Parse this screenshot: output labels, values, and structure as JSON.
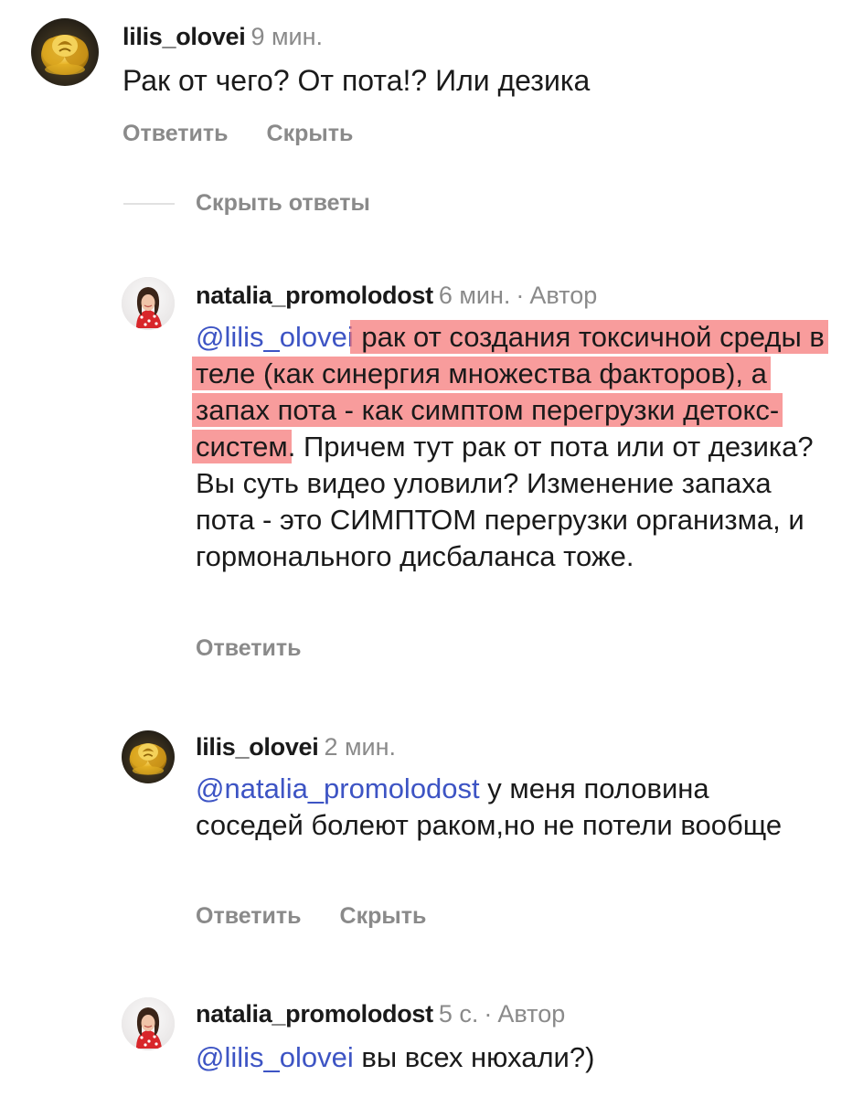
{
  "comments": [
    {
      "author": "lilis_olovei",
      "time": "9 мин.",
      "text": "Рак от чего? От пота!? Или дезика",
      "actions": [
        "Ответить",
        "Скрыть"
      ]
    },
    {
      "author": "natalia_promolodost",
      "time": "6 мин.",
      "separator": "·",
      "badge": "Автор",
      "mention": "@lilis_olovei",
      "highlighted_text": " рак от создания токсичной среды в теле (как синергия множества факторов), а запах пота - как симптом перегрузки детокс-систем",
      "text_after": ". Причем тут рак от пота или от дезика? Вы суть видео уловили? Изменение запаха пота - это СИМПТОМ перегрузки организма, и гормонального дисбаланса тоже.",
      "actions": [
        "Ответить"
      ]
    },
    {
      "author": "lilis_olovei",
      "time": "2 мин.",
      "mention": "@natalia_promolodost",
      "text": " у меня половина соседей болеют раком,но не потели вообще",
      "actions": [
        "Ответить",
        "Скрыть"
      ]
    },
    {
      "author": "natalia_promolodost",
      "time": "5 с.",
      "separator": "·",
      "badge": "Автор",
      "mention": "@lilis_olovei",
      "text": " вы всех нюхали?)"
    }
  ],
  "thread": {
    "hide_replies_label": "Скрыть ответы"
  },
  "colors": {
    "mention": "#3d54c4",
    "highlight": "#f57676",
    "muted": "#8a8a8a"
  },
  "icons": {
    "rose_avatar": "golden-rose-avatar",
    "author_avatar": "woman-red-dress-avatar"
  }
}
